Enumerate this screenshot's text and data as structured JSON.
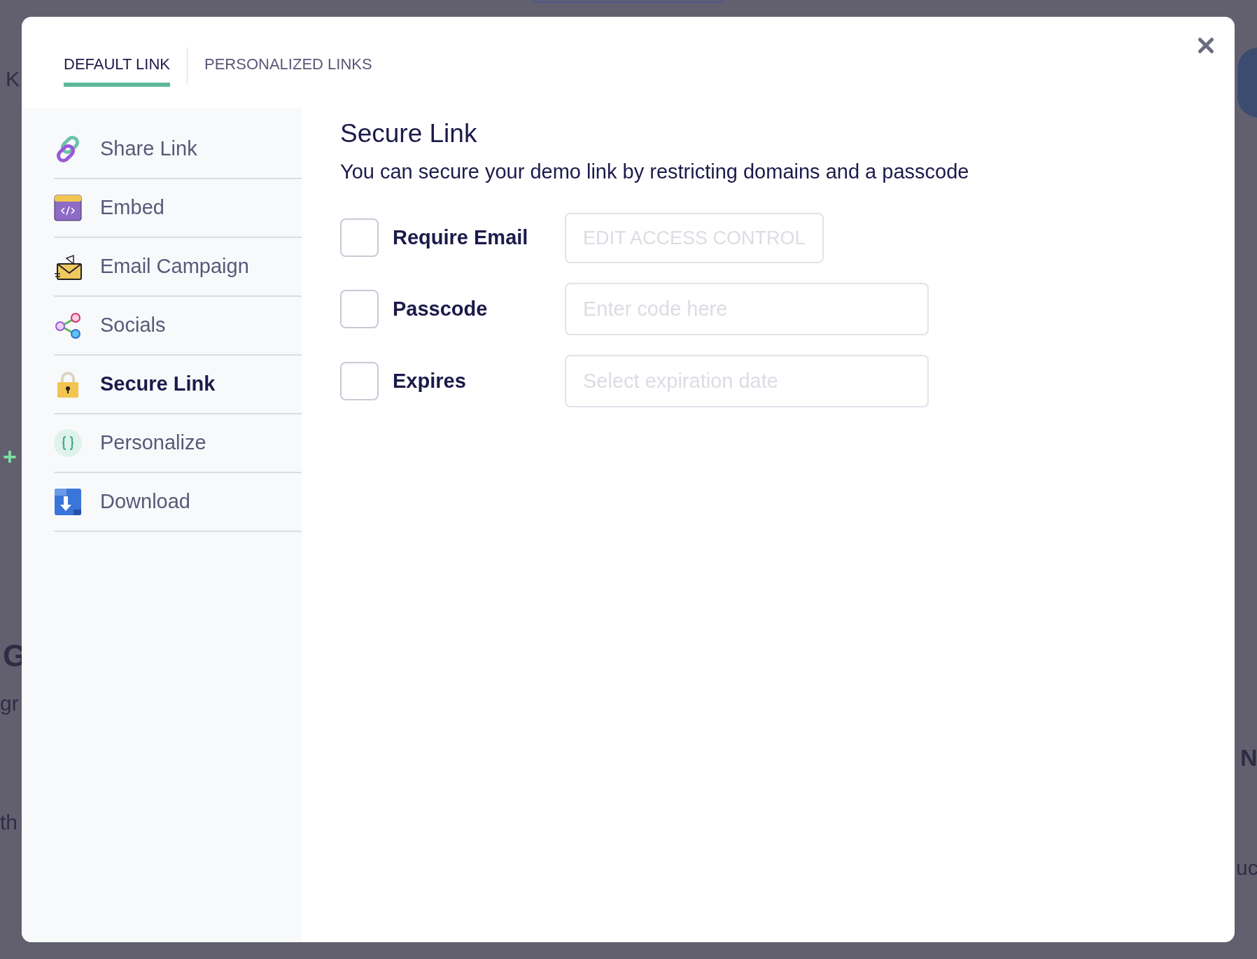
{
  "background_fragments": [
    "K",
    "+",
    "G",
    "gr",
    "th",
    "N",
    "uc"
  ],
  "tabs": [
    {
      "label": "DEFAULT LINK",
      "selected": true
    },
    {
      "label": "PERSONALIZED LINKS",
      "selected": false
    }
  ],
  "sidebar": {
    "items": [
      {
        "label": "Share Link",
        "kind": "link",
        "selected": false
      },
      {
        "label": "Embed",
        "kind": "embed",
        "selected": false
      },
      {
        "label": "Email Campaign",
        "kind": "email",
        "selected": false
      },
      {
        "label": "Socials",
        "kind": "socials",
        "selected": false
      },
      {
        "label": "Secure Link",
        "kind": "lock",
        "selected": true
      },
      {
        "label": "Personalize",
        "kind": "braces",
        "selected": false
      },
      {
        "label": "Download",
        "kind": "download",
        "selected": false
      }
    ]
  },
  "content": {
    "title": "Secure Link",
    "subtitle": "You can secure your demo link by restricting domains and a passcode",
    "options": [
      {
        "label": "Require Email",
        "checked": false,
        "control": {
          "kind": "button",
          "label": "EDIT ACCESS CONTROL",
          "disabled": true
        }
      },
      {
        "label": "Passcode",
        "checked": false,
        "control": {
          "kind": "input",
          "placeholder": "Enter code here"
        }
      },
      {
        "label": "Expires",
        "checked": false,
        "control": {
          "kind": "input",
          "placeholder": "Select expiration date"
        }
      }
    ]
  }
}
